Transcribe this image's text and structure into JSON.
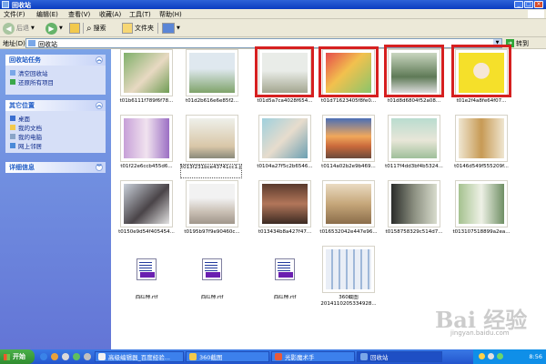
{
  "window": {
    "title": "回收站"
  },
  "menu": [
    "文件(F)",
    "编辑(E)",
    "查看(V)",
    "收藏(A)",
    "工具(T)",
    "帮助(H)"
  ],
  "toolbar": {
    "back": "后退",
    "search": "搜索",
    "folders": "文件夹"
  },
  "address": {
    "label": "地址(D)",
    "value": "回收站",
    "go": "转到"
  },
  "sidebar": {
    "tasks": {
      "title": "回收站任务",
      "items": [
        "清空回收站",
        "还原所有项目"
      ]
    },
    "places": {
      "title": "其它位置",
      "items": [
        "桌面",
        "我的文档",
        "我的电脑",
        "网上邻居"
      ]
    },
    "details": {
      "title": "详细信息"
    }
  },
  "files": [
    "t01b6111f789f6f78...",
    "t01d2b616e6e85f2...",
    "t01d5a7ca4028f654...",
    "t01d71623405f8fe0...",
    "t01d8d6804f52a08...",
    "t01e2f4a8fe64f07...",
    "t01f22e6ccb455d6...",
    "t013f231bce43741cc1.jpg",
    "t0104a27f5c2b6546...",
    "t0114a02b2e9b469...",
    "t0117f4dd3bf4b5324...",
    "t0146d549f555209f...",
    "t0150e9d54f405454...",
    "t0195b97f9e90460c...",
    "t013434b8a427f47...",
    "t016532042e447e96...",
    "t0158758329c514d7...",
    "t013107518899a2ea...",
    "西红柿.rtf",
    "西红柿.rtf",
    "西红柿.rtf",
    "360截图2014110205334928..."
  ],
  "taskbar": {
    "start": "开始",
    "tasks": [
      "高级编辑器_百度经验...",
      "360截图",
      "光影魔术手",
      "回收站"
    ],
    "clock": "8:56"
  },
  "watermark": {
    "text": "Bai 经验",
    "sub": "jingyan.baidu.com"
  },
  "colors": {
    "highlight": "#d62020",
    "title_bar": "#0a3cc0",
    "sidebar": "#6f8fdc",
    "start": "#3a9d3a"
  }
}
